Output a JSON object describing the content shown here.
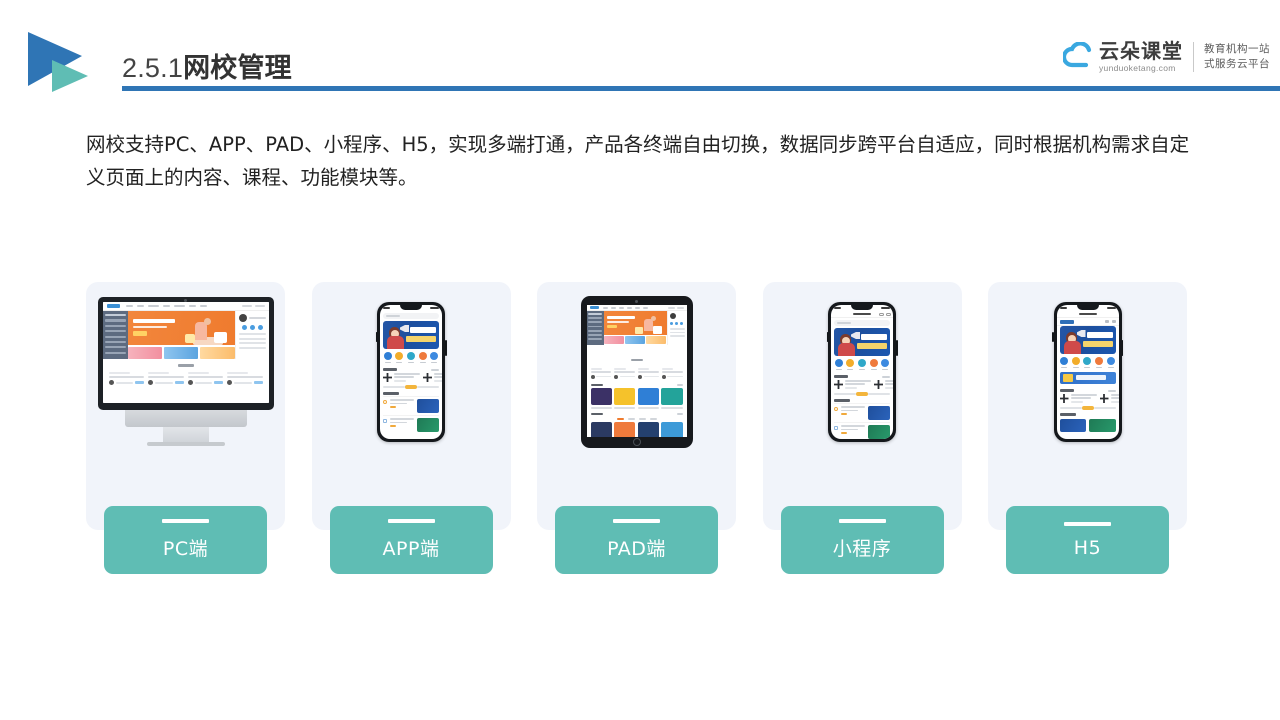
{
  "header": {
    "title_number": "2.5.1",
    "title_text": "网校管理",
    "rule_color": "#2f75b5",
    "logo_colors": {
      "primary": "#2f75b5",
      "secondary": "#5fbdb4"
    }
  },
  "brand": {
    "name_zh": "云朵课堂",
    "domain": "yunduoketang.com",
    "tagline_line1": "教育机构一站",
    "tagline_line2": "式服务云平台",
    "cloud_color": "#3aa8e0"
  },
  "body_text": {
    "paragraph": "网校支持PC、APP、PAD、小程序、H5，实现多端打通，产品各终端自由切换，数据同步跨平台自适应，同时根据机构需求自定义页面上的内容、课程、功能模块等。"
  },
  "cards": [
    {
      "label": "PC端",
      "device": "imac",
      "panel_color": "#f1f4fa",
      "label_color": "#5fbdb4"
    },
    {
      "label": "APP端",
      "device": "phone",
      "panel_color": "#f1f4fa",
      "label_color": "#5fbdb4"
    },
    {
      "label": "PAD端",
      "device": "tablet",
      "panel_color": "#f1f4fa",
      "label_color": "#5fbdb4"
    },
    {
      "label": "小程序",
      "device": "phone",
      "panel_color": "#f1f4fa",
      "label_color": "#5fbdb4"
    },
    {
      "label": "H5",
      "device": "phone",
      "panel_color": "#f1f4fa",
      "label_color": "#5fbdb4"
    }
  ]
}
